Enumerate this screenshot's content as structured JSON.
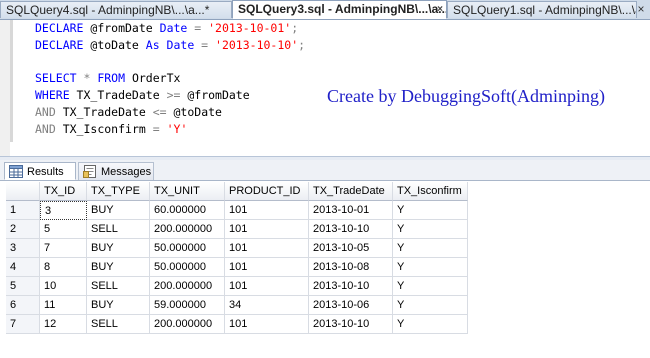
{
  "tabs": [
    {
      "label": "SQLQuery4.sql - AdminpingNB\\...\\a...*",
      "active": false
    },
    {
      "label": "SQLQuery3.sql - AdminpingNB\\...\\a...*",
      "active": true
    },
    {
      "label": "SQLQuery1.sql - AdminpingNB\\...\\a...*",
      "active": false
    }
  ],
  "tab_pin": "×",
  "close_glyph": "×",
  "code": {
    "l1": {
      "kw1": "DECLARE",
      "var": " @fromDate ",
      "kw2": "Date",
      "op": " = ",
      "str": "'2013-10-01'",
      "end": ";"
    },
    "l2": {
      "kw1": "DECLARE",
      "var": " @toDate ",
      "kw2": "As Date",
      "op": " = ",
      "str": "'2013-10-10'",
      "end": ";"
    },
    "l3": {
      "kw1": "SELECT",
      "op1": " * ",
      "kw2": "FROM",
      "rest": " OrderTx"
    },
    "l4": {
      "kw1": "WHERE",
      "a": " TX_TradeDate ",
      "op": ">=",
      "b": " @fromDate"
    },
    "l5": {
      "kw1": "AND",
      "a": " TX_TradeDate ",
      "op": "<=",
      "b": " @toDate"
    },
    "l6": {
      "kw1": "AND",
      "a": " TX_Isconfirm ",
      "op": "=",
      "sp": " ",
      "str": "'Y'"
    }
  },
  "watermark": "Create by DebuggingSoft(Adminping)",
  "result_tabs": {
    "results": "Results",
    "messages": "Messages"
  },
  "grid": {
    "columns": [
      "TX_ID",
      "TX_TYPE",
      "TX_UNIT",
      "PRODUCT_ID",
      "TX_TradeDate",
      "TX_Isconfirm"
    ],
    "rows": [
      {
        "n": "1",
        "cells": [
          "3",
          "BUY",
          "60.000000",
          "101",
          "2013-10-01",
          "Y"
        ]
      },
      {
        "n": "2",
        "cells": [
          "5",
          "SELL",
          "200.000000",
          "101",
          "2013-10-10",
          "Y"
        ]
      },
      {
        "n": "3",
        "cells": [
          "7",
          "BUY",
          "50.000000",
          "101",
          "2013-10-05",
          "Y"
        ]
      },
      {
        "n": "4",
        "cells": [
          "8",
          "BUY",
          "50.000000",
          "101",
          "2013-10-08",
          "Y"
        ]
      },
      {
        "n": "5",
        "cells": [
          "10",
          "SELL",
          "200.000000",
          "101",
          "2013-10-10",
          "Y"
        ]
      },
      {
        "n": "6",
        "cells": [
          "11",
          "BUY",
          "59.000000",
          "34",
          "2013-10-06",
          "Y"
        ]
      },
      {
        "n": "7",
        "cells": [
          "12",
          "SELL",
          "200.000000",
          "101",
          "2013-10-10",
          "Y"
        ]
      }
    ]
  }
}
